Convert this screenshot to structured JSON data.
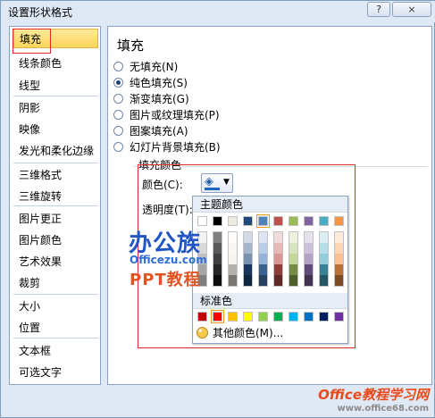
{
  "window": {
    "title": "设置形状格式",
    "help_btn": "?",
    "close_btn": "×"
  },
  "sidebar": {
    "items": [
      "填充",
      "线条颜色",
      "线型",
      "阴影",
      "映像",
      "发光和柔化边缘",
      "三维格式",
      "三维旋转",
      "图片更正",
      "图片颜色",
      "艺术效果",
      "裁剪",
      "大小",
      "位置",
      "文本框",
      "可选文字"
    ],
    "active": "填充"
  },
  "fill": {
    "heading": "填充",
    "options": [
      "无填充(N)",
      "纯色填充(S)",
      "渐变填充(G)",
      "图片或纹理填充(P)",
      "图案填充(A)",
      "幻灯片背景填充(B)"
    ],
    "selected": "纯色填充(S)",
    "group_label": "填充颜色",
    "color_label": "颜色(C):",
    "transparency_label": "透明度(T):"
  },
  "color_popup": {
    "theme_header": "主题颜色",
    "theme_colors": [
      "#ffffff",
      "#000000",
      "#eeece1",
      "#1f497d",
      "#4f81bd",
      "#c0504d",
      "#9bbb59",
      "#8064a2",
      "#4bacc6",
      "#f79646"
    ],
    "selected_theme": "#4f81bd",
    "standard_header": "标准色",
    "standard_colors": [
      "#c00000",
      "#ff0000",
      "#ffc000",
      "#ffff00",
      "#92d050",
      "#00b050",
      "#00b0f0",
      "#0070c0",
      "#002060",
      "#7030a0"
    ],
    "more_colors": "其他颜色(M)..."
  },
  "watermark": {
    "logo": "办公族",
    "site": "Officezu.com",
    "label": "PPT教程",
    "corner_title": "Office教程学习网",
    "corner_url": "www.office68.com"
  }
}
